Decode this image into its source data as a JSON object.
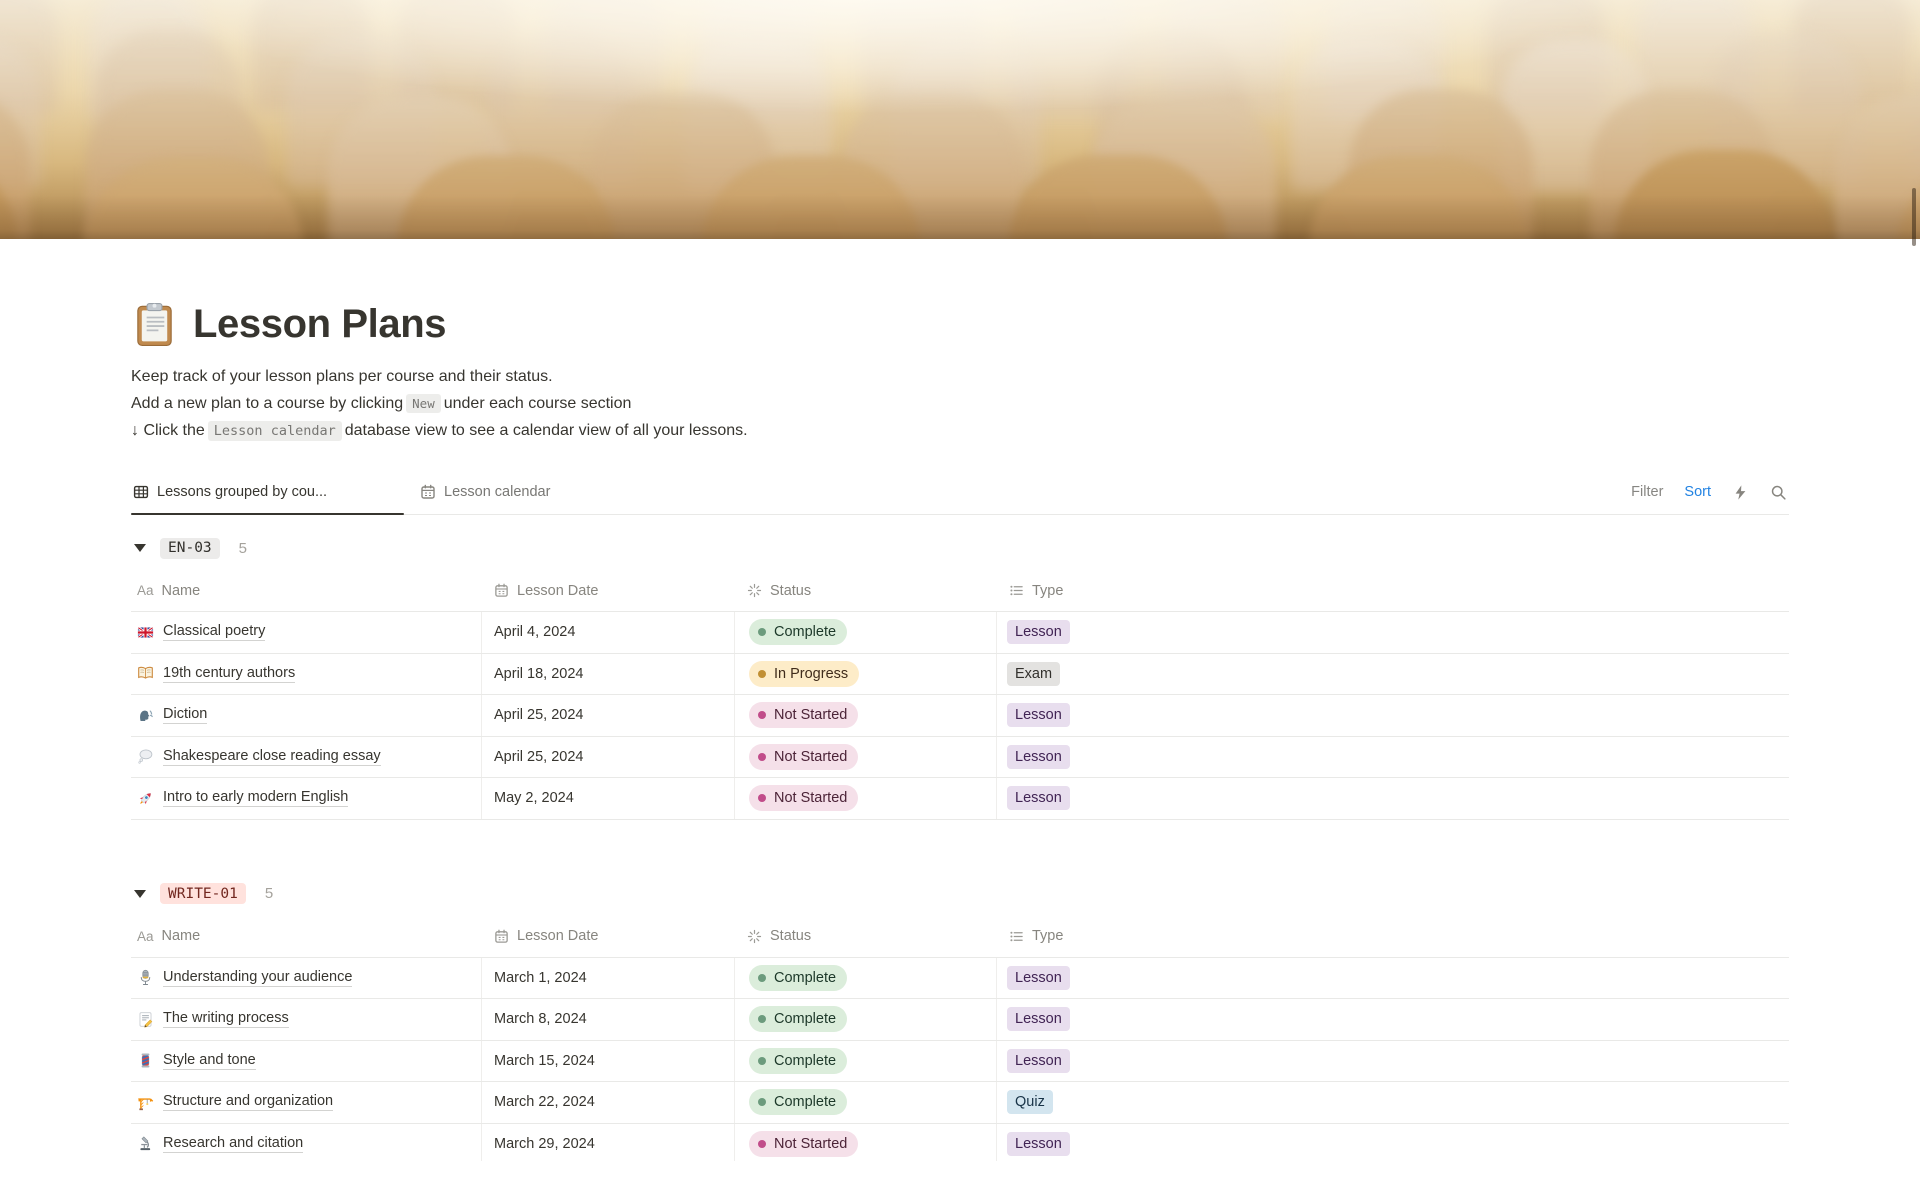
{
  "page": {
    "title": "Lesson Plans",
    "icon": "clipboard"
  },
  "description": {
    "line1": "Keep track of your lesson plans per course and their status.",
    "line2_pre": "Add a new plan to a course by clicking",
    "line2_chip": "New",
    "line2_post": "under each course section",
    "line3_pre": "↓ Click the",
    "line3_chip": "Lesson calendar",
    "line3_post": "database view to see a calendar view of all your lessons."
  },
  "toolbar": {
    "tabs": [
      {
        "label": "Lessons grouped by cou...",
        "icon": "table-view-icon",
        "active": true
      },
      {
        "label": "Lesson calendar",
        "icon": "calendar-view-icon",
        "active": false
      }
    ],
    "filter_label": "Filter",
    "sort_label": "Sort",
    "accent_blue": "#2383E2"
  },
  "table": {
    "columns": [
      {
        "label": "Name",
        "icon": "text-property-icon"
      },
      {
        "label": "Lesson Date",
        "icon": "date-property-icon"
      },
      {
        "label": "Status",
        "icon": "status-property-icon"
      },
      {
        "label": "Type",
        "icon": "select-property-icon"
      }
    ]
  },
  "groups": [
    {
      "tag": "EN-03",
      "count": "5",
      "tag_bg": "#ECEBEA",
      "tag_color": "#32302C",
      "rows": [
        {
          "icon": "uk-flag",
          "name": "Classical poetry",
          "date": "April 4, 2024",
          "status": "Complete",
          "type": "Lesson"
        },
        {
          "icon": "open-book",
          "name": "19th century authors",
          "date": "April 18, 2024",
          "status": "In Progress",
          "type": "Exam"
        },
        {
          "icon": "speaking-head",
          "name": "Diction",
          "date": "April 25, 2024",
          "status": "Not Started",
          "type": "Lesson"
        },
        {
          "icon": "thought-balloon",
          "name": "Shakespeare close reading essay",
          "date": "April 25, 2024",
          "status": "Not Started",
          "type": "Lesson"
        },
        {
          "icon": "rocket",
          "name": "Intro to early modern English",
          "date": "May 2, 2024",
          "status": "Not Started",
          "type": "Lesson"
        }
      ]
    },
    {
      "tag": "WRITE-01",
      "count": "5",
      "tag_bg": "#FFE2DD",
      "tag_color": "#72271F",
      "rows": [
        {
          "icon": "microphone",
          "name": "Understanding your audience",
          "date": "March 1, 2024",
          "status": "Complete",
          "type": "Lesson"
        },
        {
          "icon": "memo",
          "name": "The writing process",
          "date": "March 8, 2024",
          "status": "Complete",
          "type": "Lesson"
        },
        {
          "icon": "barber-pole",
          "name": "Style and tone",
          "date": "March 15, 2024",
          "status": "Complete",
          "type": "Lesson"
        },
        {
          "icon": "crane",
          "name": "Structure and organization",
          "date": "March 22, 2024",
          "status": "Complete",
          "type": "Quiz"
        },
        {
          "icon": "microscope",
          "name": "Research and citation",
          "date": "March 29, 2024",
          "status": "Not Started",
          "type": "Lesson"
        }
      ]
    }
  ],
  "status_styles": {
    "Complete": {
      "bg": "#DBEDDB",
      "dot": "#6C9B7D",
      "text": "#1C3829"
    },
    "In Progress": {
      "bg": "#FDECC8",
      "dot": "#C18F33",
      "text": "#402C1B"
    },
    "Not Started": {
      "bg": "#F5E0E9",
      "dot": "#C14C8A",
      "text": "#4C2337"
    }
  },
  "type_styles": {
    "Lesson": {
      "bg": "#E8DEEE",
      "text": "#412454"
    },
    "Exam": {
      "bg": "#E3E2E0",
      "text": "#32302C"
    },
    "Quiz": {
      "bg": "#D3E5EF",
      "text": "#183347"
    }
  }
}
